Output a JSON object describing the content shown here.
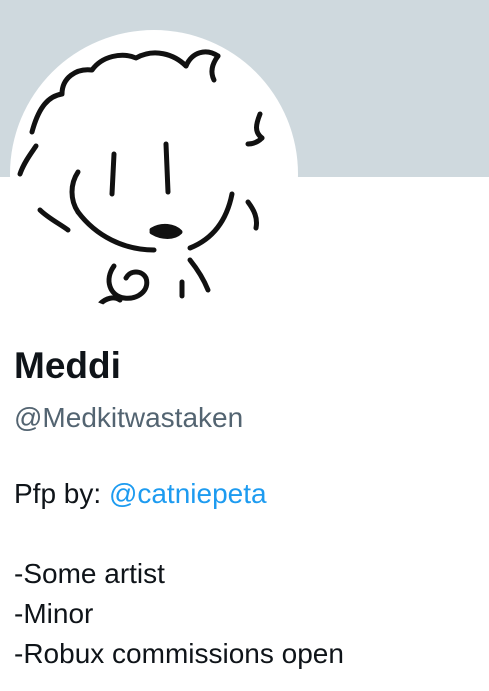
{
  "profile": {
    "display_name": "Meddi",
    "handle": "@Medkitwastaken"
  },
  "bio": {
    "pfp_prefix": "Pfp by: ",
    "pfp_mention": "@catniepeta",
    "lines": [
      "-Some artist",
      "-Minor",
      "-Robux commissions open"
    ]
  },
  "colors": {
    "banner": "#cfd9de",
    "name": "#0f1419",
    "handle": "#536471",
    "mention": "#1d9bf0"
  }
}
